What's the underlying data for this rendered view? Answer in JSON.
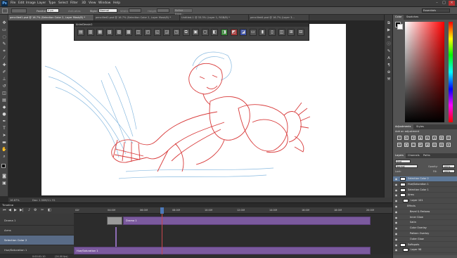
{
  "app": {
    "logo": "Ps"
  },
  "menu": [
    "File",
    "Edit",
    "Image",
    "Layer",
    "Type",
    "Select",
    "Filter",
    "3D",
    "View",
    "Window",
    "Help"
  ],
  "options_bar": {
    "feather_label": "Feather:",
    "feather_value": "0 px",
    "antialias_label": "Anti-alias",
    "style_label": "Style:",
    "style_value": "Normal",
    "width_label": "Width:",
    "height_label": "Height:",
    "refine_button": "Refine Edge...",
    "workspace": "Essentials"
  },
  "doc_tabs": [
    {
      "label": "pencilled1.psd @ 16.7% (Selection Color 2, Layer Mask/8) *",
      "active": true
    },
    {
      "label": "pencilled2.psd @ 16.7% (Selection Color 2, Layer Mask/8) *",
      "active": false
    },
    {
      "label": "Untitled-1 @ 33.3% (Layer 1, RGB/8) *",
      "active": false
    },
    {
      "label": "pencilled4.psd @ 16.7% (Layer 3...",
      "active": false
    }
  ],
  "anim_panel": {
    "title": "AnimDessin2",
    "button_count": 24
  },
  "status": {
    "zoom": "16.67%",
    "doc": "Doc: 1.50M/11.7G"
  },
  "timeline": {
    "title": "Timeline",
    "ruler_ticks": [
      "02f",
      "04:00f",
      "06:00f",
      "08:00f",
      "10:00f",
      "12:00f",
      "14:00f",
      "16:00f",
      "18:00f",
      "20:00f"
    ],
    "tracks": [
      {
        "label": "Drama 1",
        "selected": false
      },
      {
        "label": "Arms",
        "selected": false
      },
      {
        "label": "Selection Color 2",
        "selected": true
      },
      {
        "label": "Hue/Saturation 1",
        "selected": false
      }
    ],
    "clips": [
      {
        "label": "Drama 1"
      },
      {
        "label": "Hue/Saturation 1"
      }
    ],
    "timecode": "0:00:01:10",
    "fps": "(24.00 fps)"
  },
  "right_panels": {
    "color_tabs": [
      "Color",
      "Swatches"
    ],
    "adjustments_tabs": [
      "Adjustments",
      "Styles"
    ],
    "adjustments_header": "Add an adjustment",
    "adjustment_icon_count": 16,
    "layers_tabs": [
      "Layers",
      "Channels",
      "Paths"
    ],
    "kind_label": "Kind",
    "blend_mode": "Normal",
    "opacity_label": "Opacity:",
    "opacity_value": "100%",
    "lock_label": "Lock:",
    "fill_label": "Fill:",
    "fill_value": "100%",
    "layers": [
      {
        "name": "Selection Color 2",
        "selected": true,
        "indent": 0
      },
      {
        "name": "Hue/Saturation 1",
        "selected": false,
        "indent": 0
      },
      {
        "name": "Selection Color 1",
        "selected": false,
        "indent": 0
      },
      {
        "name": "Arms",
        "selected": false,
        "indent": 0
      },
      {
        "name": "Layer 101",
        "selected": false,
        "indent": 1
      },
      {
        "name": "Effects",
        "selected": false,
        "indent": 2
      },
      {
        "name": "Bevel & Emboss",
        "selected": false,
        "indent": 3
      },
      {
        "name": "Inner Glow",
        "selected": false,
        "indent": 3
      },
      {
        "name": "Satin",
        "selected": false,
        "indent": 3
      },
      {
        "name": "Color Overlay",
        "selected": false,
        "indent": 3
      },
      {
        "name": "Pattern Overlay",
        "selected": false,
        "indent": 3
      },
      {
        "name": "Outer Glow",
        "selected": false,
        "indent": 3
      },
      {
        "name": "Softspots",
        "selected": false,
        "indent": 0
      },
      {
        "name": "Layer 98",
        "selected": false,
        "indent": 1
      }
    ]
  },
  "colors": {
    "menubar": "#3c3c3c",
    "panel": "#535353",
    "selection": "#5e7898",
    "clip": "#7b5a9e",
    "sketch_red": "#d83a3a",
    "sketch_blue": "#6aa8d8",
    "playhead": "#c8474d"
  }
}
